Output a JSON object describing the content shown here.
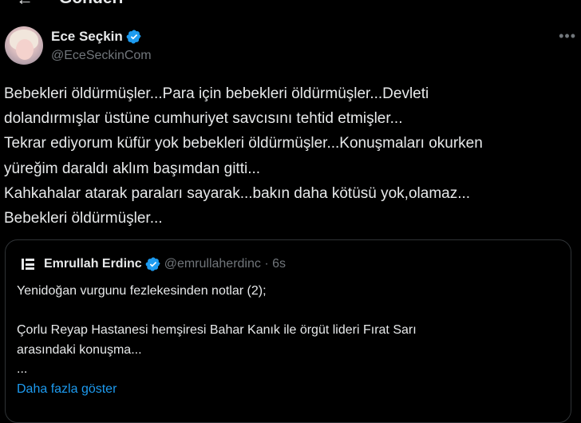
{
  "header": {
    "title": "Gönderi",
    "back_icon": "arrow-left-icon"
  },
  "author": {
    "display_name": "Ece Seçkin",
    "handle": "@EceSeckinCom",
    "verified": true,
    "more_icon": "more-horizontal-icon"
  },
  "tweet": {
    "text": "Bebekleri öldürmüşler...Para için bebekleri öldürmüşler...Devleti\ndolandırmışlar üstüne cumhuriyet savcısını tehtid etmişler...\nTekrar ediyorum küfür yok bebekleri öldürmüşler...Konuşmaları okurken\nyüreğim daraldı aklım başımdan gitti...\nKahkahalar atarak paraları sayarak...bakın daha kötüsü yok,olamaz...\nBebekleri öldürmüşler..."
  },
  "quote": {
    "display_name": "Emrullah Erdinc",
    "handle_time": "@emrullaherdinc · 6s",
    "verified": true,
    "text": "Yenidoğan vurgunu fezlekesinden notlar (2);\n\nÇorlu Reyap Hastanesi hemşiresi Bahar Kanık ile örgüt lideri Fırat Sarı\narasındaki konuşma...\n...",
    "show_more": "Daha fazla göster"
  },
  "colors": {
    "background": "#000000",
    "text": "#e7e9ea",
    "secondary": "#71767b",
    "accent": "#1d9bf0"
  }
}
